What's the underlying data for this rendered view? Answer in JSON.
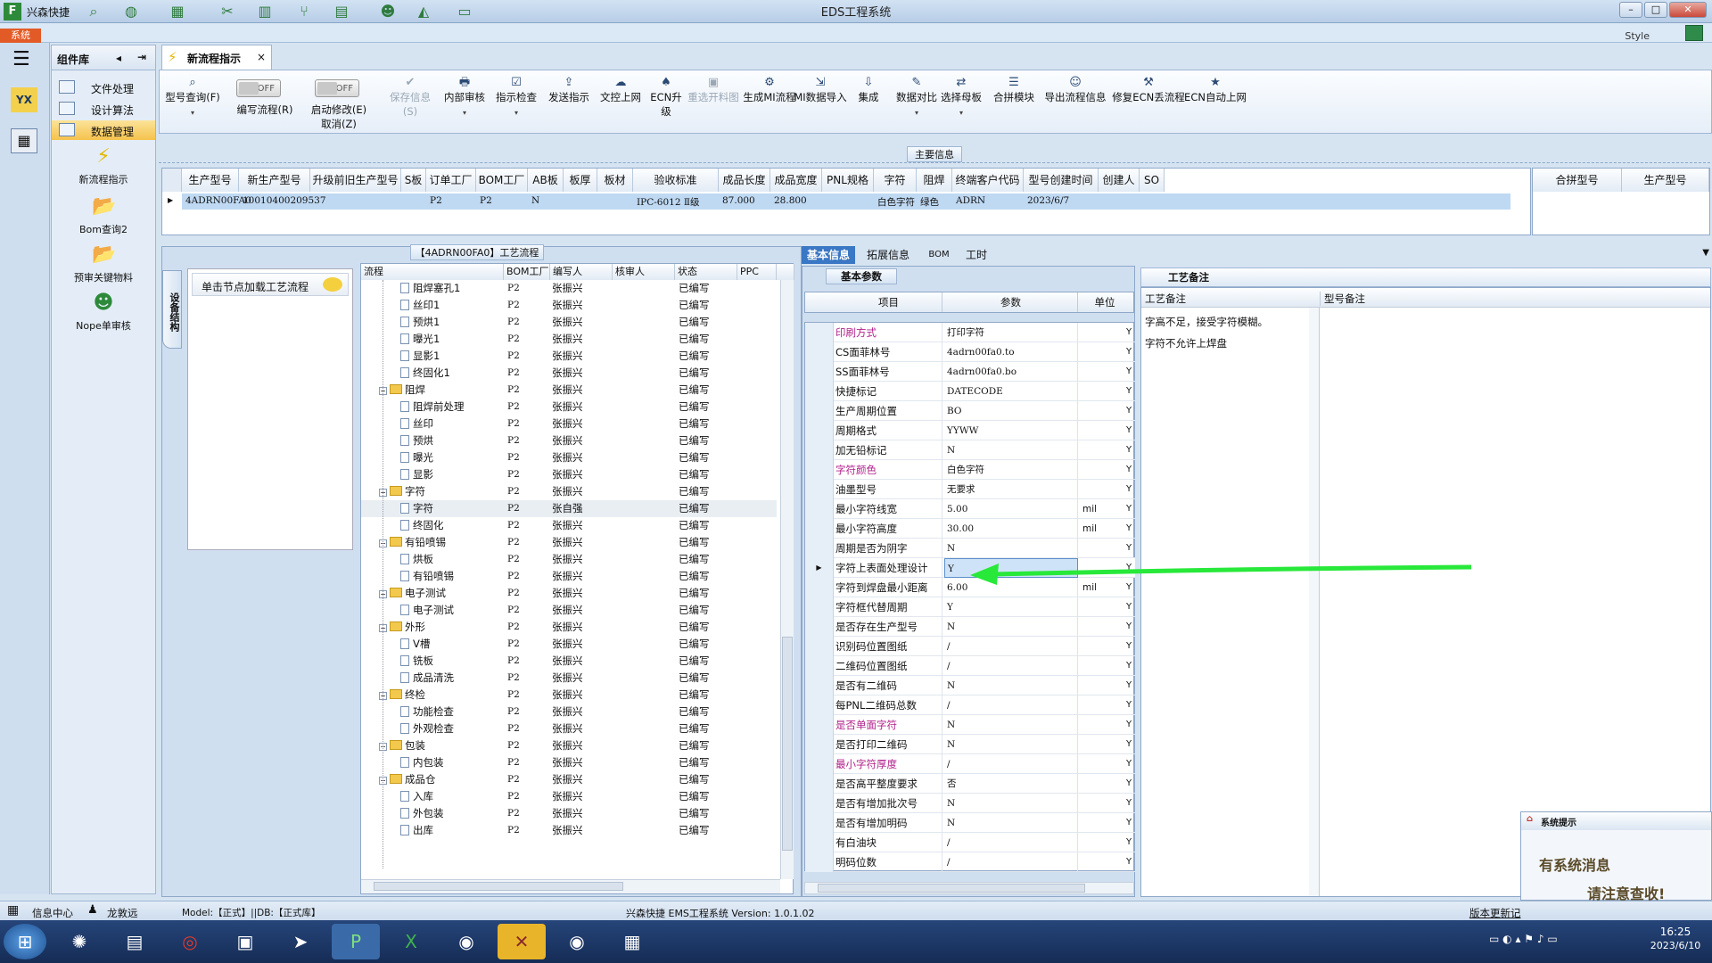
{
  "window": {
    "title": "EDS工程系统",
    "app_name": "兴森快捷",
    "sys_tab": "系统",
    "style_label": "Style"
  },
  "sidebar": {
    "title": "组件库",
    "items": [
      {
        "label": "文件处理"
      },
      {
        "label": "设计算法"
      },
      {
        "label": "数据管理"
      }
    ],
    "big_items": [
      {
        "label": "新流程指示"
      },
      {
        "label": "Bom查询2"
      },
      {
        "label": "预审关键物料"
      },
      {
        "label": "Nope单审核"
      }
    ]
  },
  "doc_tab": {
    "label": "新流程指示"
  },
  "ribbon": {
    "query": "型号查询(F)",
    "write_flow": "编写流程(R)",
    "write_toggle": "OFF",
    "start_modify": "启动修改(E)",
    "cancel": "取消(Z)",
    "start_toggle": "OFF",
    "buttons": [
      {
        "label": "保存信息(S)",
        "icon": "✔",
        "disabled": true
      },
      {
        "label": "内部审核",
        "icon": "🖶",
        "disabled": false
      },
      {
        "label": "指示检查",
        "icon": "☑",
        "disabled": false
      },
      {
        "label": "发送指示",
        "icon": "⇪",
        "disabled": false
      },
      {
        "label": "文控上网",
        "icon": "☁",
        "disabled": false
      },
      {
        "label": "ECN升级",
        "icon": "♠",
        "disabled": false
      },
      {
        "label": "重选开料图",
        "icon": "▣",
        "disabled": true
      },
      {
        "label": "生成MI流程",
        "icon": "⚙",
        "disabled": false
      },
      {
        "label": "MI数据导入",
        "icon": "⇲",
        "disabled": false
      },
      {
        "label": "集成",
        "icon": "⇩",
        "disabled": false
      },
      {
        "label": "数据对比",
        "icon": "✎",
        "disabled": false
      },
      {
        "label": "选择母板",
        "icon": "⇄",
        "disabled": false
      },
      {
        "label": "合拼模块",
        "icon": "☰",
        "disabled": false
      },
      {
        "label": "导出流程信息",
        "icon": "☺",
        "disabled": false
      },
      {
        "label": "修复ECN丢流程",
        "icon": "⚒",
        "disabled": false
      },
      {
        "label": "ECN自动上网",
        "icon": "★",
        "disabled": false
      }
    ]
  },
  "main_info": {
    "title": "主要信息",
    "headers": [
      "生产型号",
      "新生产型号",
      "升级前旧生产型号",
      "S板",
      "订单工厂",
      "BOM工厂",
      "AB板",
      "板厚",
      "板材",
      "验收标准",
      "成品长度",
      "成品宽度",
      "PNL规格",
      "字符",
      "阻焊",
      "终端客户代码",
      "型号创建时间",
      "创建人",
      "SO"
    ],
    "row": [
      "4ADRN00FA0",
      "10010400209537",
      "",
      "",
      "P2",
      "P2",
      "N",
      "",
      "",
      "IPC-6012 Ⅱ级",
      "87.000",
      "28.800",
      "",
      "白色字符",
      "绿色",
      "ADRN",
      "2023/6/7",
      "",
      ""
    ],
    "right_headers": [
      "合拼型号",
      "生产型号"
    ]
  },
  "flow_panel": {
    "title": "【4ADRN00FA0】工艺流程",
    "vtab": "设备结构",
    "load_btn": "单击节点加载工艺流程",
    "headers": [
      "流程",
      "BOM工厂",
      "编写人",
      "核审人",
      "状态",
      "PPC"
    ],
    "rows": [
      {
        "name": "阻焊塞孔1",
        "lvl": 2,
        "type": "leaf",
        "bom": "P2",
        "writer": "张振兴",
        "status": "已编写"
      },
      {
        "name": "丝印1",
        "lvl": 2,
        "type": "leaf",
        "bom": "P2",
        "writer": "张振兴",
        "status": "已编写"
      },
      {
        "name": "预烘1",
        "lvl": 2,
        "type": "leaf",
        "bom": "P2",
        "writer": "张振兴",
        "status": "已编写"
      },
      {
        "name": "曝光1",
        "lvl": 2,
        "type": "leaf",
        "bom": "P2",
        "writer": "张振兴",
        "status": "已编写"
      },
      {
        "name": "显影1",
        "lvl": 2,
        "type": "leaf",
        "bom": "P2",
        "writer": "张振兴",
        "status": "已编写"
      },
      {
        "name": "终固化1",
        "lvl": 2,
        "type": "leaf",
        "bom": "P2",
        "writer": "张振兴",
        "status": "已编写"
      },
      {
        "name": "阻焊",
        "lvl": 1,
        "type": "folder",
        "bom": "P2",
        "writer": "张振兴",
        "status": "已编写"
      },
      {
        "name": "阻焊前处理",
        "lvl": 2,
        "type": "leaf",
        "bom": "P2",
        "writer": "张振兴",
        "status": "已编写"
      },
      {
        "name": "丝印",
        "lvl": 2,
        "type": "leaf",
        "bom": "P2",
        "writer": "张振兴",
        "status": "已编写"
      },
      {
        "name": "预烘",
        "lvl": 2,
        "type": "leaf",
        "bom": "P2",
        "writer": "张振兴",
        "status": "已编写"
      },
      {
        "name": "曝光",
        "lvl": 2,
        "type": "leaf",
        "bom": "P2",
        "writer": "张振兴",
        "status": "已编写"
      },
      {
        "name": "显影",
        "lvl": 2,
        "type": "leaf",
        "bom": "P2",
        "writer": "张振兴",
        "status": "已编写"
      },
      {
        "name": "字符",
        "lvl": 1,
        "type": "folder",
        "bom": "P2",
        "writer": "张振兴",
        "status": "已编写"
      },
      {
        "name": "字符",
        "lvl": 2,
        "type": "leaf",
        "bom": "P2",
        "writer": "张自强",
        "status": "已编写",
        "sel": true
      },
      {
        "name": "终固化",
        "lvl": 2,
        "type": "leaf",
        "bom": "P2",
        "writer": "张振兴",
        "status": "已编写"
      },
      {
        "name": "有铅喷锡",
        "lvl": 1,
        "type": "folder",
        "bom": "P2",
        "writer": "张振兴",
        "status": "已编写"
      },
      {
        "name": "烘板",
        "lvl": 2,
        "type": "leaf",
        "bom": "P2",
        "writer": "张振兴",
        "status": "已编写"
      },
      {
        "name": "有铅喷锡",
        "lvl": 2,
        "type": "leaf",
        "bom": "P2",
        "writer": "张振兴",
        "status": "已编写"
      },
      {
        "name": "电子测试",
        "lvl": 1,
        "type": "folder",
        "bom": "P2",
        "writer": "张振兴",
        "status": "已编写"
      },
      {
        "name": "电子测试",
        "lvl": 2,
        "type": "leaf",
        "bom": "P2",
        "writer": "张振兴",
        "status": "已编写"
      },
      {
        "name": "外形",
        "lvl": 1,
        "type": "folder",
        "bom": "P2",
        "writer": "张振兴",
        "status": "已编写"
      },
      {
        "name": "V槽",
        "lvl": 2,
        "type": "leaf",
        "bom": "P2",
        "writer": "张振兴",
        "status": "已编写"
      },
      {
        "name": "铣板",
        "lvl": 2,
        "type": "leaf",
        "bom": "P2",
        "writer": "张振兴",
        "status": "已编写"
      },
      {
        "name": "成品清洗",
        "lvl": 2,
        "type": "leaf",
        "bom": "P2",
        "writer": "张振兴",
        "status": "已编写"
      },
      {
        "name": "终检",
        "lvl": 1,
        "type": "folder",
        "bom": "P2",
        "writer": "张振兴",
        "status": "已编写"
      },
      {
        "name": "功能检查",
        "lvl": 2,
        "type": "leaf",
        "bom": "P2",
        "writer": "张振兴",
        "status": "已编写"
      },
      {
        "name": "外观检查",
        "lvl": 2,
        "type": "leaf",
        "bom": "P2",
        "writer": "张振兴",
        "status": "已编写"
      },
      {
        "name": "包装",
        "lvl": 1,
        "type": "folder",
        "bom": "P2",
        "writer": "张振兴",
        "status": "已编写"
      },
      {
        "name": "内包装",
        "lvl": 2,
        "type": "leaf",
        "bom": "P2",
        "writer": "张振兴",
        "status": "已编写"
      },
      {
        "name": "成品仓",
        "lvl": 1,
        "type": "folder",
        "bom": "P2",
        "writer": "张振兴",
        "status": "已编写"
      },
      {
        "name": "入库",
        "lvl": 2,
        "type": "leaf",
        "bom": "P2",
        "writer": "张振兴",
        "status": "已编写"
      },
      {
        "name": "外包装",
        "lvl": 2,
        "type": "leaf",
        "bom": "P2",
        "writer": "张振兴",
        "status": "已编写"
      },
      {
        "name": "出库",
        "lvl": 2,
        "type": "leaf",
        "bom": "P2",
        "writer": "张振兴",
        "status": "已编写"
      }
    ]
  },
  "info_tabs": [
    "基本信息",
    "拓展信息",
    "BOM",
    "工时"
  ],
  "params": {
    "title": "基本参数",
    "headers": [
      "项目",
      "参数",
      "单位"
    ],
    "rows": [
      {
        "k": "印刷方式",
        "v": "打印字符",
        "u": "",
        "pink": true
      },
      {
        "k": "CS面菲林号",
        "v": "4adrn00fa0.to",
        "u": ""
      },
      {
        "k": "SS面菲林号",
        "v": "4adrn00fa0.bo",
        "u": ""
      },
      {
        "k": "快捷标记",
        "v": "DATECODE",
        "u": ""
      },
      {
        "k": "生产周期位置",
        "v": "BO",
        "u": ""
      },
      {
        "k": "周期格式",
        "v": "YYWW",
        "u": ""
      },
      {
        "k": "加无铅标记",
        "v": "N",
        "u": ""
      },
      {
        "k": "字符颜色",
        "v": "白色字符",
        "u": "",
        "pink": true
      },
      {
        "k": "油墨型号",
        "v": "无要求",
        "u": ""
      },
      {
        "k": "最小字符线宽",
        "v": "5.00",
        "u": "mil"
      },
      {
        "k": "最小字符高度",
        "v": "30.00",
        "u": "mil"
      },
      {
        "k": "周期是否为阴字",
        "v": "N",
        "u": ""
      },
      {
        "k": "字符上表面处理设计",
        "v": "Y",
        "u": "",
        "sel": true
      },
      {
        "k": "字符到焊盘最小距离",
        "v": "6.00",
        "u": "mil"
      },
      {
        "k": "字符框代替周期",
        "v": "Y",
        "u": ""
      },
      {
        "k": "是否存在生产型号",
        "v": "N",
        "u": ""
      },
      {
        "k": "识别码位置图纸",
        "v": "/",
        "u": ""
      },
      {
        "k": "二维码位置图纸",
        "v": "/",
        "u": ""
      },
      {
        "k": "是否有二维码",
        "v": "N",
        "u": ""
      },
      {
        "k": "每PNL二维码总数",
        "v": "/",
        "u": ""
      },
      {
        "k": "是否单面字符",
        "v": "N",
        "u": "",
        "pink": true
      },
      {
        "k": "是否打印二维码",
        "v": "N",
        "u": ""
      },
      {
        "k": "最小字符厚度",
        "v": "/",
        "u": "",
        "pink": true
      },
      {
        "k": "是否高平整度要求",
        "v": "否",
        "u": ""
      },
      {
        "k": "是否有增加批次号",
        "v": "N",
        "u": ""
      },
      {
        "k": "是否有增加明码",
        "v": "N",
        "u": ""
      },
      {
        "k": "有白油块",
        "v": "/",
        "u": ""
      },
      {
        "k": "明码位数",
        "v": "/",
        "u": ""
      }
    ],
    "y_flag": "Y"
  },
  "remarks": {
    "title": "工艺备注",
    "col1": "工艺备注",
    "col2": "型号备注",
    "line1": "字高不足，接受字符模糊。",
    "line2": "字符不允许上焊盘"
  },
  "status": {
    "info_center": "信息中心",
    "user": "龙敦远",
    "model": "Model:【正式】||DB:【正式库】",
    "version": "兴森快捷 EMS工程系统 Version: 1.0.1.02",
    "update": "版本更新记"
  },
  "notify": {
    "title": "系统提示",
    "line1": "有系统消息",
    "line2": "请注意查收!"
  },
  "clock": {
    "time": "16:25",
    "date": "2023/6/10"
  },
  "colors": {
    "accent": "#3a77c4",
    "arrow": "#28e83a",
    "selected": "#bfd9f3"
  }
}
